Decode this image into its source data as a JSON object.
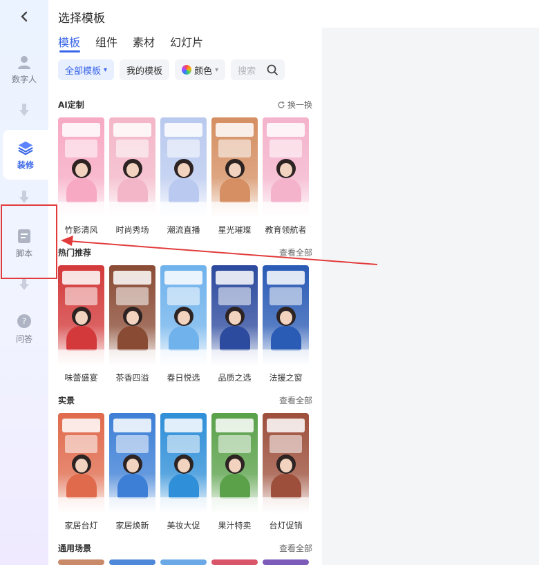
{
  "rail": {
    "items": [
      {
        "label": "数字人",
        "icon": "digital-human-icon"
      },
      {
        "label": "装修",
        "icon": "decorate-layers-icon",
        "active": true
      },
      {
        "label": "脚本",
        "icon": "script-doc-icon"
      },
      {
        "label": "问答",
        "icon": "qa-bubble-icon"
      }
    ]
  },
  "panel": {
    "title": "选择模板",
    "tabs": [
      "模板",
      "组件",
      "素材",
      "幻灯片"
    ],
    "filters": {
      "all_templates": "全部模板",
      "my_templates": "我的模板",
      "color": "颜色",
      "search_placeholder": "搜索"
    },
    "sections": [
      {
        "name": "AI定制",
        "action": "换一换",
        "cards": [
          {
            "caption": "竹影清风",
            "color": "#f7a9c3"
          },
          {
            "caption": "时尚秀场",
            "color": "#f3b6c8"
          },
          {
            "caption": "潮流直播",
            "color": "#b9c9ef"
          },
          {
            "caption": "星光璀璨",
            "color": "#d58f62"
          },
          {
            "caption": "教育领航者",
            "color": "#f4b3cb"
          }
        ]
      },
      {
        "name": "热门推荐",
        "action": "查看全部",
        "cards": [
          {
            "caption": "味蕾盛宴",
            "color": "#d3393a"
          },
          {
            "caption": "茶香四溢",
            "color": "#8a4b34"
          },
          {
            "caption": "春日悦选",
            "color": "#6fb2ec"
          },
          {
            "caption": "品质之选",
            "color": "#2c4a9e"
          },
          {
            "caption": "法援之窗",
            "color": "#2a5bb5"
          }
        ]
      },
      {
        "name": "实景",
        "action": "查看全部",
        "cards": [
          {
            "caption": "家居台灯",
            "color": "#e06a4c"
          },
          {
            "caption": "家居焕新",
            "color": "#3d7fd6"
          },
          {
            "caption": "美妆大促",
            "color": "#2f8fd8"
          },
          {
            "caption": "果汁特卖",
            "color": "#5aa14a"
          },
          {
            "caption": "台灯促销",
            "color": "#9d4f3b"
          }
        ]
      },
      {
        "name": "通用场景",
        "action": "查看全部",
        "cards": []
      }
    ]
  },
  "colors": {
    "accent": "#3a66e8",
    "annotation": "#e23b3b"
  }
}
